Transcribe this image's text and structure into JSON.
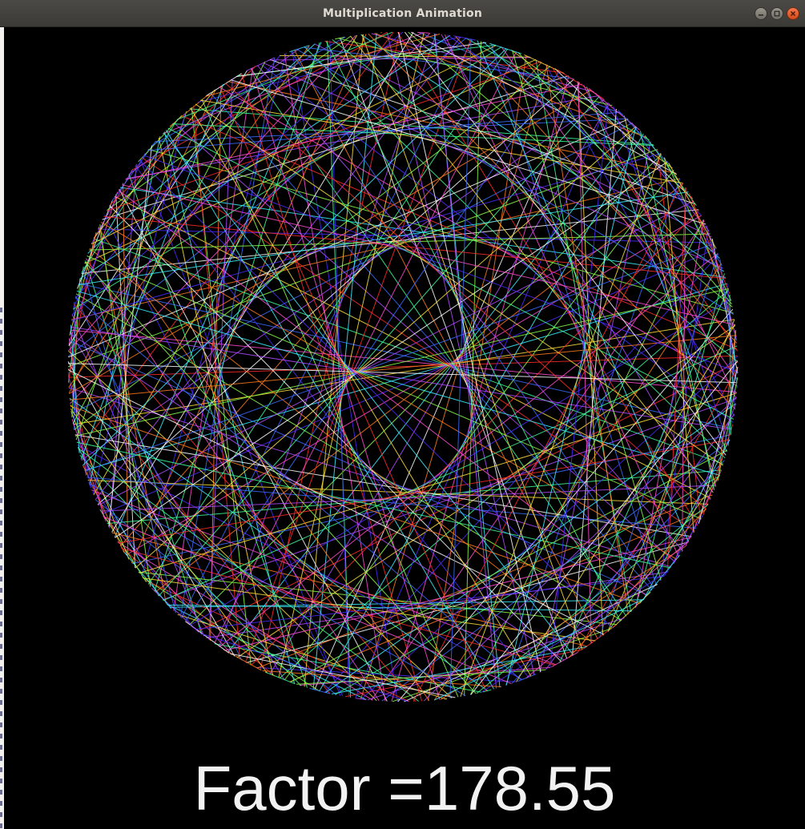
{
  "window": {
    "title": "Multiplication Animation"
  },
  "controls": {
    "minimize_icon": "minimize-icon",
    "maximize_icon": "maximize-icon",
    "close_icon": "close-icon"
  },
  "canvas": {
    "background": "#000000",
    "factor_text": "Factor =178.55",
    "factor": 178.55,
    "palette": [
      "#ff2a2a",
      "#ff7a1f",
      "#ffe23a",
      "#8cff4a",
      "#3cff9a",
      "#3af0ff",
      "#3a6bff",
      "#4a2aff",
      "#b04aff",
      "#ff4ad0",
      "#ffffff"
    ]
  }
}
